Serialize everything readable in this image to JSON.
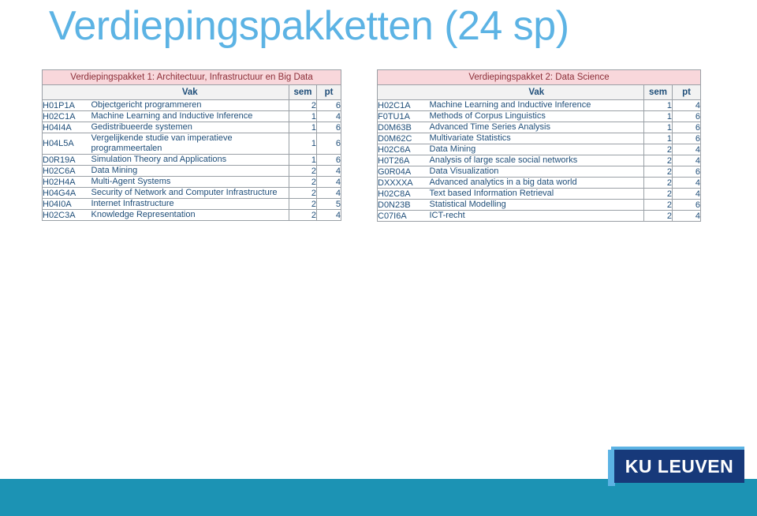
{
  "slide": {
    "title": "Verdiepingspakketten (24 sp)",
    "title_color": "#5CB3E4",
    "band_color": "#1C93B4"
  },
  "logo": {
    "text": "KU LEUVEN",
    "box_color": "#17397A",
    "accent_color": "#5CB3E4"
  },
  "tables": [
    {
      "banner": "Verdiepingspakket 1: Architectuur, Infrastructuur en Big Data",
      "banner_bg": "#F8D7DB",
      "banner_fg": "#8C2F39",
      "headers": {
        "code": "",
        "name": "Vak",
        "sem": "sem",
        "pt": "pt"
      },
      "rows": [
        {
          "code": "H01P1A",
          "name": "Objectgericht programmeren",
          "sem": "2",
          "pt": "6"
        },
        {
          "code": "H02C1A",
          "name": "Machine Learning and Inductive Inference",
          "sem": "1",
          "pt": "4"
        },
        {
          "code": "H04I4A",
          "name": "Gedistribueerde systemen",
          "sem": "1",
          "pt": "6"
        },
        {
          "code": "H04L5A",
          "name": "Vergelijkende studie van imperatieve programmeertalen",
          "sem": "1",
          "pt": "6"
        },
        {
          "code": "D0R19A",
          "name": "Simulation Theory and Applications",
          "sem": "1",
          "pt": "6"
        },
        {
          "code": "H02C6A",
          "name": "Data Mining",
          "sem": "2",
          "pt": "4"
        },
        {
          "code": "H02H4A",
          "name": "Multi-Agent Systems",
          "sem": "2",
          "pt": "4"
        },
        {
          "code": "H04G4A",
          "name": "Security of Network and Computer Infrastructure",
          "sem": "2",
          "pt": "4"
        },
        {
          "code": "H04I0A",
          "name": "Internet Infrastructure",
          "sem": "2",
          "pt": "5"
        },
        {
          "code": "H02C3A",
          "name": "Knowledge Representation",
          "sem": "2",
          "pt": "4"
        }
      ]
    },
    {
      "banner": "Verdiepingspakket 2: Data Science",
      "banner_bg": "#F8D7DB",
      "banner_fg": "#8C2F39",
      "headers": {
        "code": "",
        "name": "Vak",
        "sem": "sem",
        "pt": "pt"
      },
      "rows": [
        {
          "code": "H02C1A",
          "name": "Machine Learning and Inductive Inference",
          "sem": "1",
          "pt": "4"
        },
        {
          "code": "F0TU1A",
          "name": "Methods of Corpus Linguistics",
          "sem": "1",
          "pt": "6"
        },
        {
          "code": "D0M63B",
          "name": "Advanced Time Series Analysis",
          "sem": "1",
          "pt": "6"
        },
        {
          "code": "D0M62C",
          "name": "Multivariate Statistics",
          "sem": "1",
          "pt": "6"
        },
        {
          "code": "H02C6A",
          "name": "Data Mining",
          "sem": "2",
          "pt": "4"
        },
        {
          "code": "H0T26A",
          "name": "Analysis of large scale social networks",
          "sem": "2",
          "pt": "4"
        },
        {
          "code": "G0R04A",
          "name": "Data Visualization",
          "sem": "2",
          "pt": "6"
        },
        {
          "code": "DXXXXA",
          "name": "Advanced analytics in a big data world",
          "sem": "2",
          "pt": "4"
        },
        {
          "code": "H02C8A",
          "name": "Text based Information Retrieval",
          "sem": "2",
          "pt": "4"
        },
        {
          "code": "D0N23B",
          "name": "Statistical Modelling",
          "sem": "2",
          "pt": "6"
        },
        {
          "code": "C07I6A",
          "name": "ICT-recht",
          "sem": "2",
          "pt": "4"
        }
      ]
    }
  ]
}
